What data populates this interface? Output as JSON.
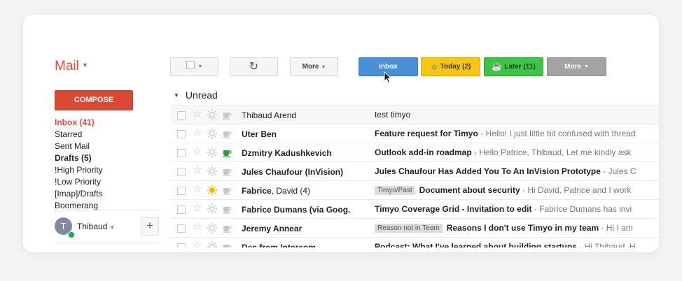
{
  "app": {
    "title": "Mail"
  },
  "compose": {
    "label": "COMPOSE"
  },
  "sidebar": {
    "items": [
      {
        "label": "Inbox (41)"
      },
      {
        "label": "Starred"
      },
      {
        "label": "Sent Mail"
      },
      {
        "label": "Drafts (5)"
      },
      {
        "label": "!High Priority"
      },
      {
        "label": "!Low Priority"
      },
      {
        "label": "[Imap]/Drafts"
      },
      {
        "label": "Boomerang"
      }
    ]
  },
  "user": {
    "initial": "T",
    "name": "Thibaud",
    "add_label": "+"
  },
  "toolbar": {
    "refresh_icon": "↻",
    "more_label": "More"
  },
  "tabs": {
    "inbox": "Inbox",
    "today": "Today (2)",
    "later": "Later (11)",
    "more": "More"
  },
  "section": {
    "title": "Unread"
  },
  "colors": {
    "accent": "#dd4b39",
    "inbox_tab": "#4a90d9",
    "today_tab": "#f7c515",
    "later_tab": "#3ec548",
    "more_tab": "#a3a3a3"
  },
  "emails": [
    {
      "sender": "Thibaud Arend",
      "count": "",
      "label": "",
      "subject": "test timyo",
      "snippet": "",
      "unread": false,
      "sun_active": false,
      "cup_active": false
    },
    {
      "sender": "Uter Ben",
      "count": "",
      "label": "",
      "subject": "Feature request for Timyo",
      "snippet": " - Hello! I just little bit confused with thread",
      "unread": true,
      "sun_active": false,
      "cup_active": false
    },
    {
      "sender": "Dzmitry Kadushkevich",
      "count": "",
      "label": "",
      "subject": "Outlook add-in roadmap",
      "snippet": " - Hello Patrice, Thibaud, Let me kindly ask",
      "unread": true,
      "sun_active": false,
      "cup_active": true
    },
    {
      "sender": "Jules Chaufour (InVision)",
      "count": "",
      "label": "",
      "subject": "Jules Chaufour Has Added You To An InVision Prototype",
      "snippet": " - Jules C",
      "unread": true,
      "sun_active": false,
      "cup_active": false
    },
    {
      "sender": "Fabrice",
      "count": ", David (4)",
      "label": "Timyo/Past",
      "subject": "Document about security",
      "snippet": " - Hi David, Patrice and I work",
      "unread": true,
      "sun_active": true,
      "cup_active": false
    },
    {
      "sender": "Fabrice Dumans (via Goog.",
      "count": "",
      "label": "",
      "subject": "Timyo Coverage Grid - Invitation to edit",
      "snippet": " - Fabrice Dumans has invi",
      "unread": true,
      "sun_active": false,
      "cup_active": false
    },
    {
      "sender": "Jeremy Annear",
      "count": "",
      "label": "Reason not in Team",
      "subject": "Reasons I don't use Timyo in my team",
      "snippet": " - Hi I am",
      "unread": true,
      "sun_active": false,
      "cup_active": false
    },
    {
      "sender": "Des from Intercom",
      "count": "",
      "label": "",
      "subject": "Podcast: What I've learned about building startups",
      "snippet": " - Hi Thibaud, H",
      "unread": true,
      "sun_active": false,
      "cup_active": false
    }
  ]
}
